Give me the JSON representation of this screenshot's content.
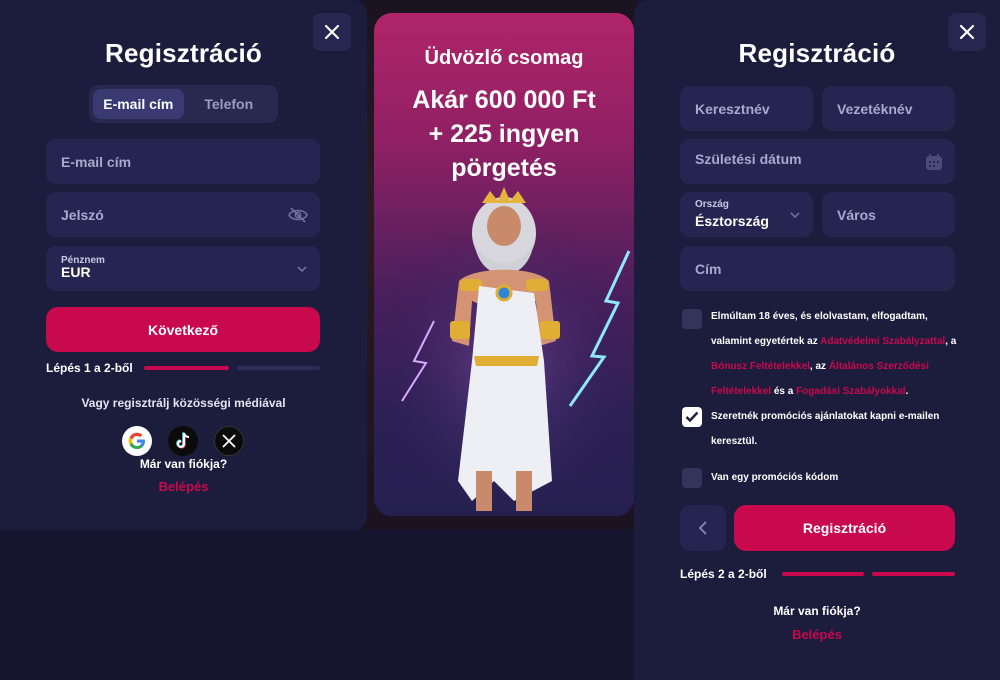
{
  "left_form": {
    "title": "Regisztráció",
    "tabs": [
      {
        "label": "E-mail cím",
        "active": true
      },
      {
        "label": "Telefon",
        "active": false
      }
    ],
    "email_placeholder": "E-mail cím",
    "password_placeholder": "Jelszó",
    "currency_label": "Pénznem",
    "currency_value": "EUR",
    "next_button": "Következő",
    "step_text": "Lépés 1 a 2-ből",
    "step_progress": 0.5,
    "social_text": "Vagy regisztrálj közösségi médiával",
    "social_icons": [
      "google-icon",
      "tiktok-icon",
      "x-icon"
    ],
    "have_account": "Már van fiókja?",
    "login_link": "Belépés"
  },
  "promo": {
    "subtitle": "Üdvözlő csomag",
    "headline_line1": "Akár 600 000 Ft",
    "headline_line2": "+ 225 ingyen",
    "headline_line3": "pörgetés"
  },
  "right_form": {
    "title": "Regisztráció",
    "first_name_placeholder": "Keresztnév",
    "last_name_placeholder": "Vezetéknév",
    "birth_date_placeholder": "Születési dátum",
    "country_label": "Ország",
    "country_value": "Észtország",
    "city_placeholder": "Város",
    "address_placeholder": "Cím",
    "terms": {
      "checked": false,
      "part1": "Elmúltam 18 éves, és elolvastam, elfogadtam,",
      "part2": "valamint egyetértek az ",
      "link1": "Adatvédelmi Szabályzattal",
      "part3": ", a",
      "link2": "Bónusz Feltételekkel",
      "part4": ", az ",
      "link3": "Általános Szerződési",
      "link3b": "Feltételekkel",
      "part5": " és a ",
      "link4": "Fogadási Szabályokkal",
      "part6": "."
    },
    "promo_emails": {
      "checked": true,
      "line1": "Szeretnék promóciós ajánlatokat kapni e-mailen",
      "line2": "keresztül."
    },
    "promo_code": {
      "checked": false,
      "label": "Van egy promóciós kódom"
    },
    "register_button": "Regisztráció",
    "step_text": "Lépés 2 a 2-ből",
    "step_progress": 1.0,
    "have_account": "Már van fiókja?",
    "login_link": "Belépés"
  },
  "colors": {
    "accent": "#c8094d",
    "panel": "#1c1c3d",
    "field": "#262551",
    "background": "#161530"
  }
}
